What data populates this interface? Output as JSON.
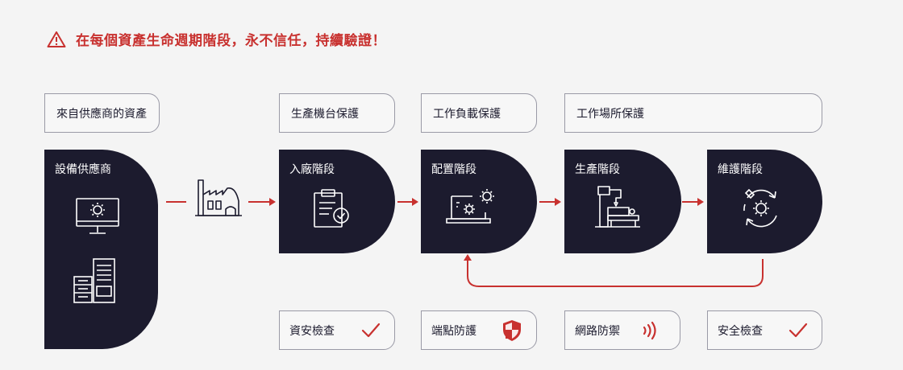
{
  "headline": {
    "text": "在每個資產生命週期階段，永不信任，持續驗證！",
    "accent_color": "#c8312f",
    "icon": "warning-triangle-icon"
  },
  "top_labels": [
    {
      "text": "來自供應商的資產"
    },
    {
      "text": "生產機台保護"
    },
    {
      "text": "工作負載保護"
    },
    {
      "text": "工作場所保護"
    }
  ],
  "stages": [
    {
      "title": "設備供應商",
      "icons": [
        "monitor-gear-icon",
        "server-building-icon"
      ]
    },
    {
      "title": "入廠階段",
      "icon": "clipboard-check-icon"
    },
    {
      "title": "配置階段",
      "icon": "laptop-gears-icon"
    },
    {
      "title": "生產階段",
      "icon": "machine-tool-icon"
    },
    {
      "title": "維護階段",
      "icon": "maintenance-cycle-icon"
    }
  ],
  "factory_icon": "factory-icon",
  "checks": [
    {
      "label": "資安檢查",
      "icon": "checkmark-icon"
    },
    {
      "label": "端點防護",
      "icon": "shield-icon"
    },
    {
      "label": "網路防禦",
      "icon": "signal-waves-icon"
    },
    {
      "label": "安全檢查",
      "icon": "checkmark-icon"
    }
  ],
  "colors": {
    "dark": "#1c1b2e",
    "accent": "#c8312f",
    "background": "#f4f4f4"
  }
}
